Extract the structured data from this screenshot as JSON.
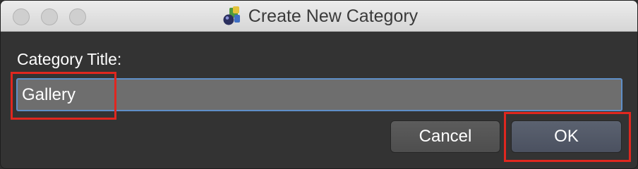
{
  "window": {
    "title": "Create New Category",
    "app_icon": "app-icon"
  },
  "form": {
    "label": "Category Title:",
    "value": "Gallery",
    "placeholder": ""
  },
  "buttons": {
    "cancel_label": "Cancel",
    "ok_label": "OK"
  },
  "colors": {
    "background": "#333333",
    "field_background": "#6e6e6e",
    "focus_ring": "#5f8fc8",
    "annotation_box": "#e0271f"
  }
}
